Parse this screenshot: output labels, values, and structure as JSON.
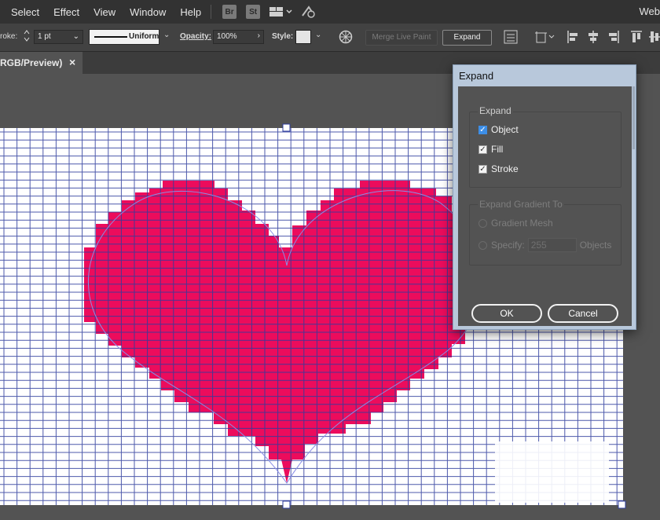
{
  "menubar": {
    "items": [
      "Select",
      "Effect",
      "View",
      "Window",
      "Help"
    ],
    "apps": [
      "Br",
      "St"
    ],
    "workspace": "Web"
  },
  "controlbar": {
    "stroke_label": "roke:",
    "stroke_weight": "1 pt",
    "profile_label": "Uniform",
    "opacity_label": "Opacity:",
    "opacity_value": "100%",
    "style_label": "Style:",
    "merge_label": "Merge Live Paint",
    "expand_label": "Expand"
  },
  "document": {
    "tab_title": "RGB/Preview)",
    "close_glyph": "×"
  },
  "dialog": {
    "title": "Expand",
    "expand_group": {
      "title": "Expand",
      "options": [
        {
          "label": "Object",
          "checked": true
        },
        {
          "label": "Fill",
          "checked": true
        },
        {
          "label": "Stroke",
          "checked": true
        }
      ]
    },
    "gradient_group": {
      "title": "Expand Gradient To",
      "option_mesh": "Gradient Mesh",
      "option_specify": "Specify:",
      "specify_value": "255",
      "specify_unit": "Objects"
    },
    "ok_label": "OK",
    "cancel_label": "Cancel"
  },
  "colors": {
    "heart": "#ec0c5c",
    "grid_line": "#2e3c9c",
    "guide_line": "#8a8ee6",
    "dialog_bg": "#535353",
    "checkbox_accent": "#3d8ee6"
  }
}
